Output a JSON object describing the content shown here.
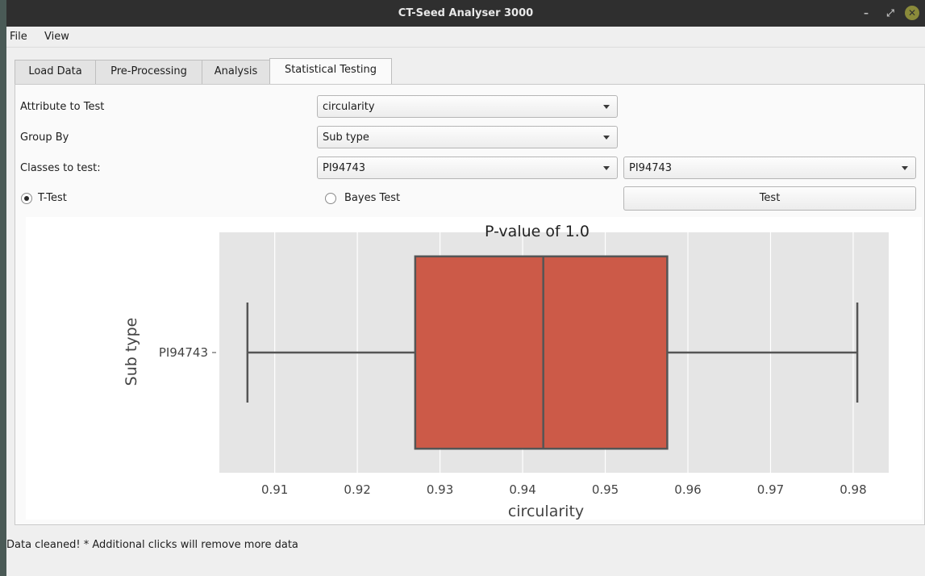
{
  "window": {
    "title": "CT-Seed Analyser 3000",
    "controls": {
      "minimize": "–",
      "maximize": "⤢",
      "close": "✕"
    }
  },
  "menu": [
    "File",
    "View"
  ],
  "tabs": [
    {
      "label": "Load Data",
      "active": false
    },
    {
      "label": "Pre-Processing",
      "active": false
    },
    {
      "label": "Analysis",
      "active": false
    },
    {
      "label": "Statistical Testing",
      "active": true
    }
  ],
  "form": {
    "attribute_label": "Attribute to Test",
    "attribute_value": "circularity",
    "group_label": "Group By",
    "group_value": "Sub type",
    "classes_label": "Classes to test:",
    "class_a_value": "PI94743",
    "class_b_value": "PI94743",
    "ttest_label": "T-Test",
    "ttest_checked": true,
    "bayes_label": "Bayes Test",
    "bayes_checked": false,
    "test_button": "Test"
  },
  "chart_data": {
    "type": "box",
    "title": "P-value of 1.0",
    "xlabel": "circularity",
    "ylabel": "Sub type",
    "xlim": [
      0.9033,
      0.9843
    ],
    "xticks": [
      "0.91",
      "0.92",
      "0.93",
      "0.94",
      "0.95",
      "0.96",
      "0.97",
      "0.98"
    ],
    "categories": [
      "PI94743"
    ],
    "boxes": [
      {
        "category": "PI94743",
        "whisker_low": 0.9067,
        "q1": 0.927,
        "median": 0.9425,
        "q3": 0.9575,
        "whisker_high": 0.9805
      }
    ],
    "box_color": "#cc5a48",
    "background": "#e5e5e5",
    "grid": true
  },
  "status": "Data cleaned! * Additional clicks will remove more data"
}
